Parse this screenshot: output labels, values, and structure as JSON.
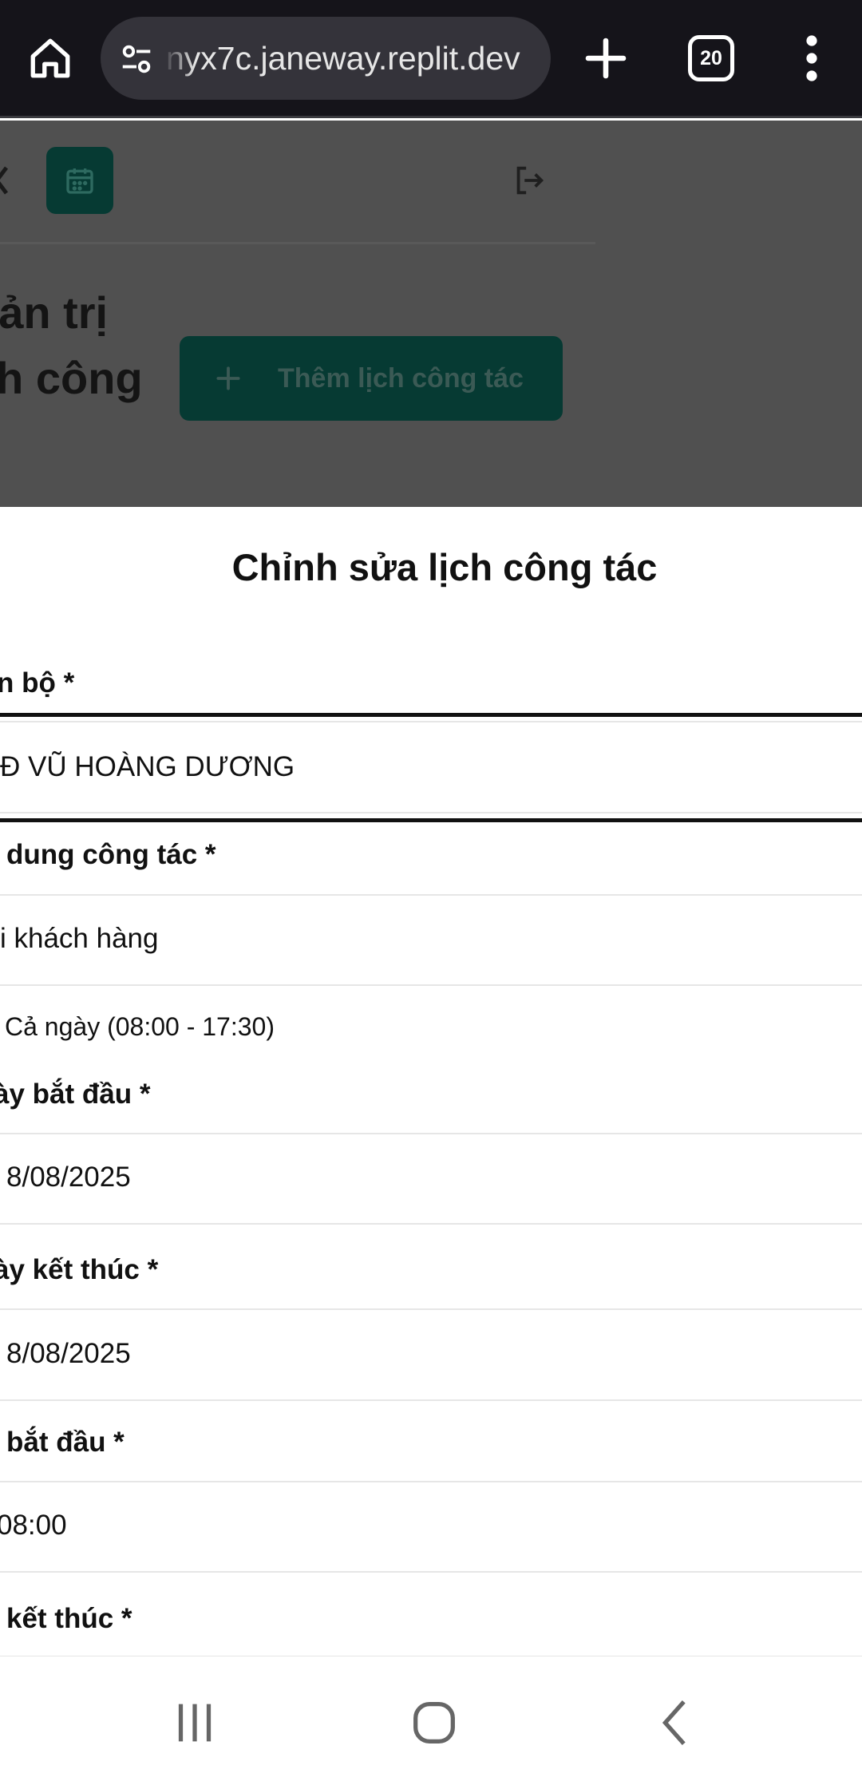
{
  "browser": {
    "url": "nyx7c.janeway.replit.dev",
    "tab_count": "20",
    "icons": {
      "home": "home-icon",
      "site_settings": "tune-icon",
      "new_tab": "plus-icon",
      "tabs": "tab-switcher-icon",
      "menu": "more-vertical-icon"
    }
  },
  "background_page": {
    "title": "uản trị ch công c",
    "add_button_label": "Thêm lịch công tác",
    "icons": {
      "calendar": "calendar-icon",
      "logout": "logout-icon"
    },
    "accent_color": "#063a33"
  },
  "sheet": {
    "title": "Chỉnh sửa lịch công tác",
    "fields": {
      "staff": {
        "label": "n bộ *",
        "value": "Đ VŨ HOÀNG DƯƠNG"
      },
      "content": {
        "label": "dung công tác *",
        "value": "i khách hàng"
      },
      "all_day": {
        "label": "Cả ngày (08:00 - 17:30)"
      },
      "start_date": {
        "label": "ày bắt đầu *",
        "value": "8/08/2025"
      },
      "end_date": {
        "label": "ày kết thúc *",
        "value": "8/08/2025"
      },
      "start_time": {
        "label": "bắt đầu *",
        "value": "08:00"
      },
      "end_time": {
        "label": "kết thúc *"
      }
    }
  },
  "system_nav": {
    "icons": {
      "recents": "recents-icon",
      "home": "home-circle-icon",
      "back": "back-icon"
    }
  }
}
